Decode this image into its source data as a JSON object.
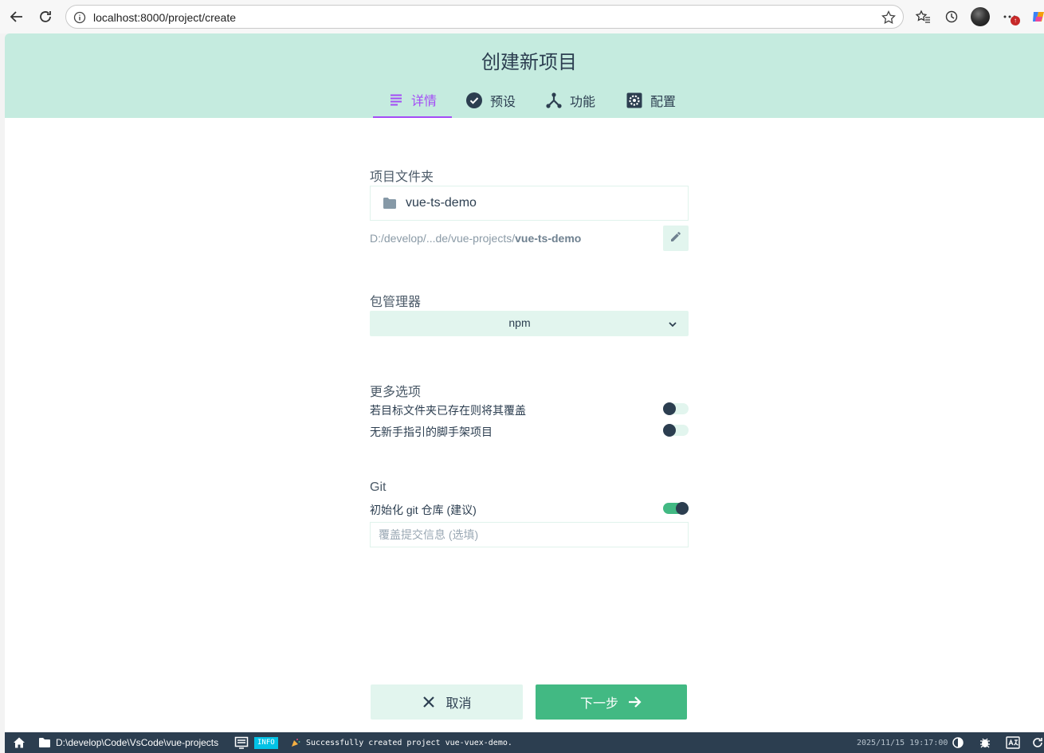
{
  "browser": {
    "url": "localhost:8000/project/create"
  },
  "page": {
    "title": "创建新项目"
  },
  "tabs": [
    {
      "label": "详情",
      "icon": "list-icon",
      "active": true
    },
    {
      "label": "预设",
      "icon": "check-circle-icon",
      "active": false
    },
    {
      "label": "功能",
      "icon": "fork-icon",
      "active": false
    },
    {
      "label": "配置",
      "icon": "settings-icon",
      "active": false
    }
  ],
  "folder": {
    "label": "项目文件夹",
    "value": "vue-ts-demo",
    "path_prefix": "D:/develop/...de/vue-projects/",
    "path_name": "vue-ts-demo"
  },
  "package_manager": {
    "label": "包管理器",
    "value": "npm"
  },
  "more_options": {
    "label": "更多选项",
    "items": [
      {
        "label": "若目标文件夹已存在则将其覆盖",
        "enabled": false
      },
      {
        "label": "无新手指引的脚手架项目",
        "enabled": false
      }
    ]
  },
  "git": {
    "label": "Git",
    "init_label": "初始化 git 仓库 (建议)",
    "init_enabled": true,
    "message_placeholder": "覆盖提交信息 (选填)"
  },
  "actions": {
    "cancel": "取消",
    "next": "下一步"
  },
  "statusbar": {
    "path": "D:\\develop\\Code\\VsCode\\vue-projects",
    "level": "INFO",
    "message": "Successfully created project vue-vuex-demo.",
    "timestamp": "2025/11/15 19:17:00"
  },
  "colors": {
    "header_bg": "#c5ebdf",
    "accent": "#42b983",
    "tab_active": "#a44cf6",
    "text": "#2c3e50",
    "statusbar_bg": "#2c3e50",
    "info_badge": "#03c2e6"
  }
}
